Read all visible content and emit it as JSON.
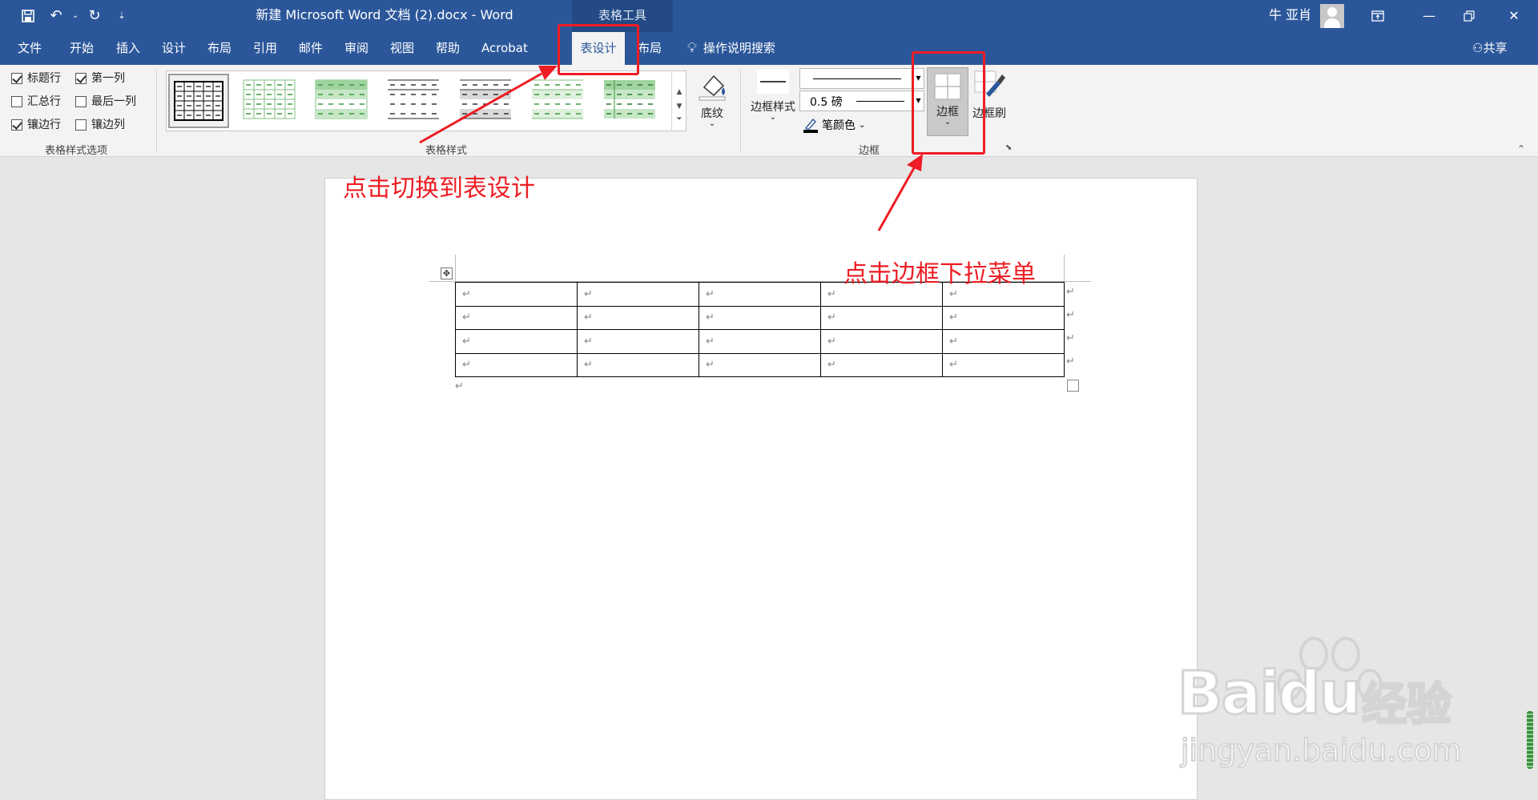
{
  "window": {
    "title": "新建 Microsoft Word 文档 (2).docx  -  Word",
    "context_tools": "表格工具",
    "user": "牛 亚肖",
    "qat_more": "⇣"
  },
  "tabs": [
    {
      "label": "文件"
    },
    {
      "label": "开始"
    },
    {
      "label": "插入"
    },
    {
      "label": "设计"
    },
    {
      "label": "布局"
    },
    {
      "label": "引用"
    },
    {
      "label": "邮件"
    },
    {
      "label": "审阅"
    },
    {
      "label": "视图"
    },
    {
      "label": "帮助"
    },
    {
      "label": "Acrobat"
    },
    {
      "label": "表设计",
      "active": true
    },
    {
      "label": "布局"
    }
  ],
  "tell_me": "操作说明搜索",
  "share": "共享",
  "style_options": {
    "items": [
      {
        "label": "标题行",
        "checked": true
      },
      {
        "label": "第一列",
        "checked": true
      },
      {
        "label": "汇总行",
        "checked": false
      },
      {
        "label": "最后一列",
        "checked": false
      },
      {
        "label": "镶边行",
        "checked": true
      },
      {
        "label": "镶边列",
        "checked": false
      }
    ],
    "group_label": "表格样式选项"
  },
  "table_styles": {
    "group_label": "表格样式",
    "shading_label": "底纹"
  },
  "borders": {
    "border_styles_label": "边框样式",
    "weight": "0.5 磅",
    "pen_color_label": "笔颜色",
    "borders_label": "边框",
    "border_painter_label": "边框刷",
    "group_label": "边框"
  },
  "document": {
    "rows": 4,
    "cols": 5,
    "cell_mark": "↵"
  },
  "annotations": {
    "switch_text": "点击切换到表设计",
    "border_text": "点击边框下拉菜单"
  },
  "watermark": {
    "brand": "Baidu",
    "cn": "经验",
    "url": "jingyan.baidu.com"
  },
  "colors": {
    "accent": "#2b579a",
    "annotation": "#ee1c24"
  }
}
